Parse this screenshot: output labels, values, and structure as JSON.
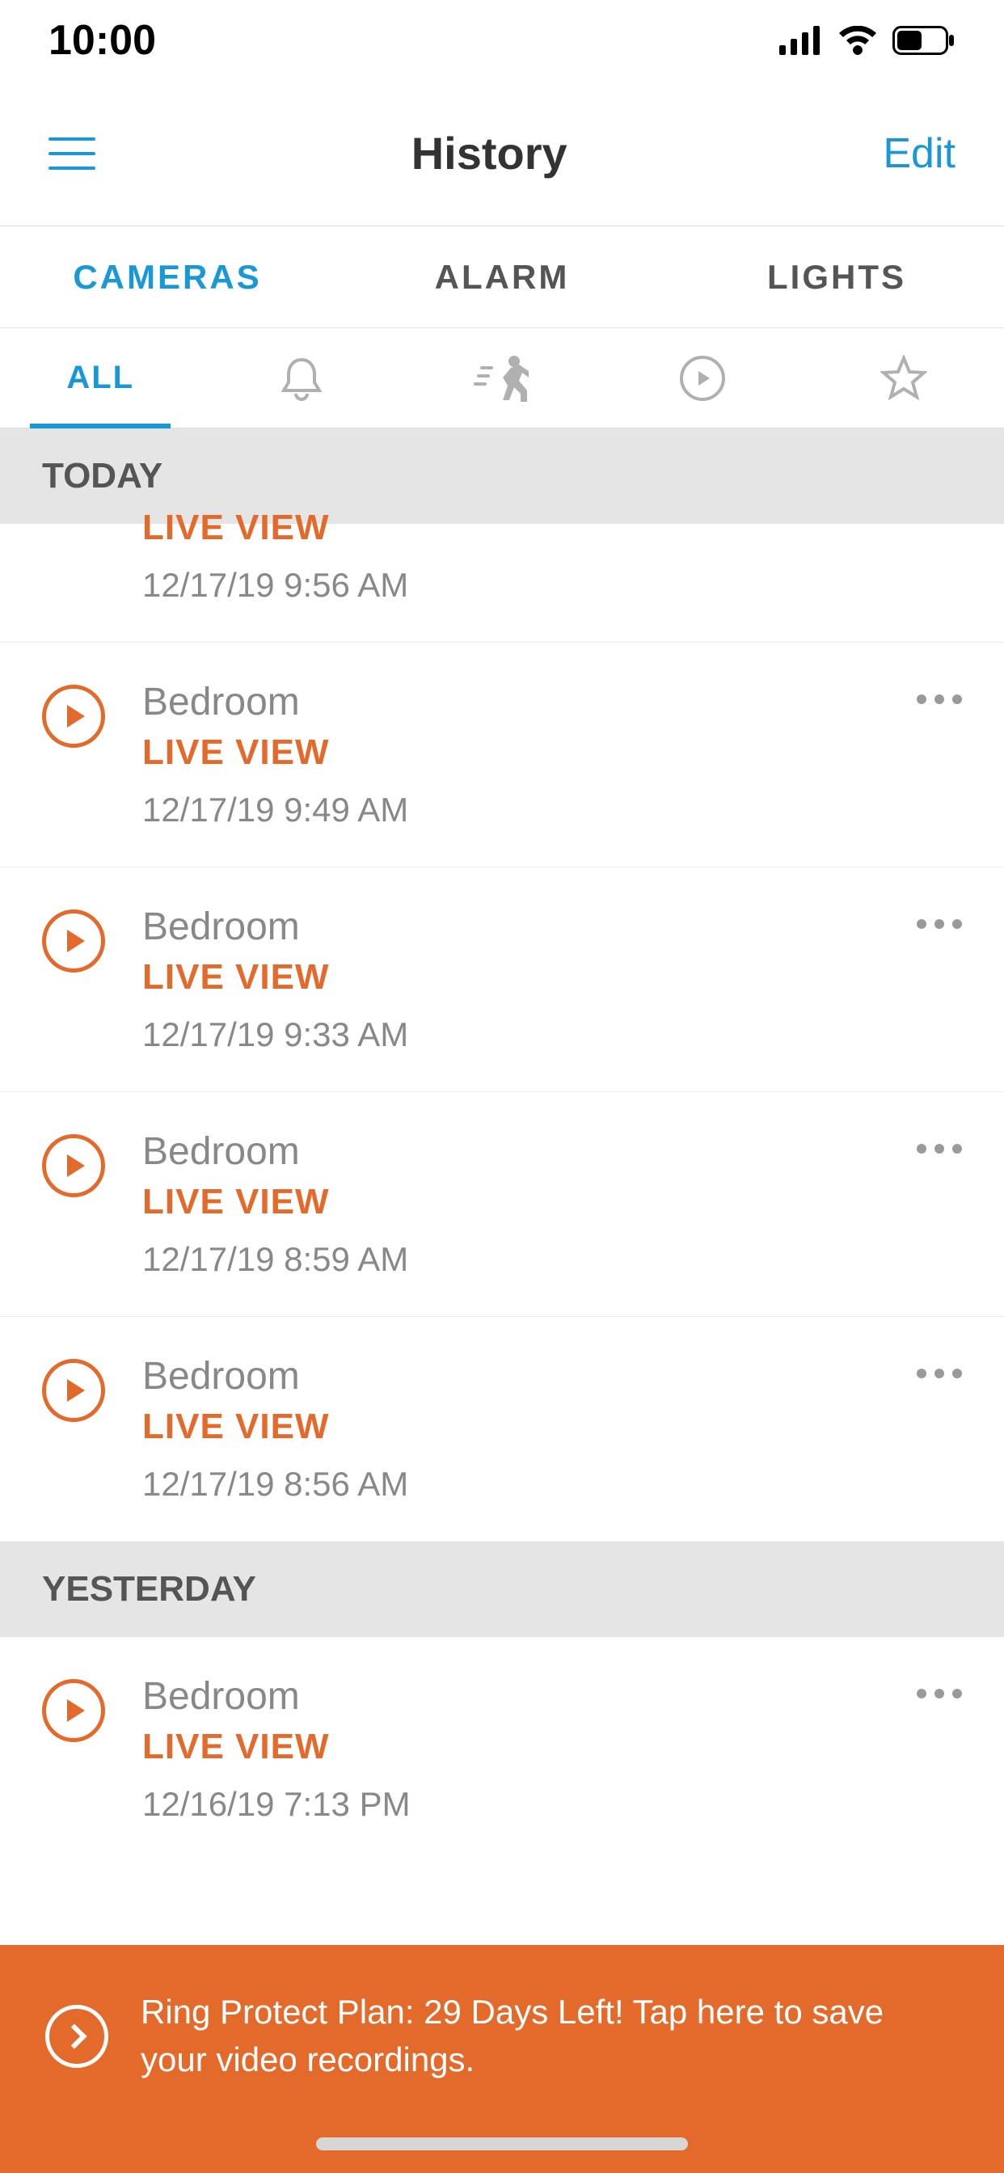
{
  "status": {
    "time": "10:00"
  },
  "nav": {
    "title": "History",
    "edit": "Edit"
  },
  "tabs": {
    "cameras": "CAMERAS",
    "alarm": "ALARM",
    "lights": "LIGHTS"
  },
  "filters": {
    "all": "ALL"
  },
  "sections": {
    "today": "TODAY",
    "yesterday": "YESTERDAY"
  },
  "events": [
    {
      "title": "",
      "live": "LIVE VIEW",
      "ts": "12/17/19  9:56 AM"
    },
    {
      "title": "Bedroom",
      "live": "LIVE VIEW",
      "ts": "12/17/19  9:49 AM"
    },
    {
      "title": "Bedroom",
      "live": "LIVE VIEW",
      "ts": "12/17/19  9:33 AM"
    },
    {
      "title": "Bedroom",
      "live": "LIVE VIEW",
      "ts": "12/17/19  8:59 AM"
    },
    {
      "title": "Bedroom",
      "live": "LIVE VIEW",
      "ts": "12/17/19  8:56 AM"
    },
    {
      "title": "Bedroom",
      "live": "LIVE VIEW",
      "ts": "12/16/19  7:13 PM"
    }
  ],
  "banner": {
    "text": "Ring Protect Plan: 29 Days Left! Tap here to save your video recordings."
  }
}
